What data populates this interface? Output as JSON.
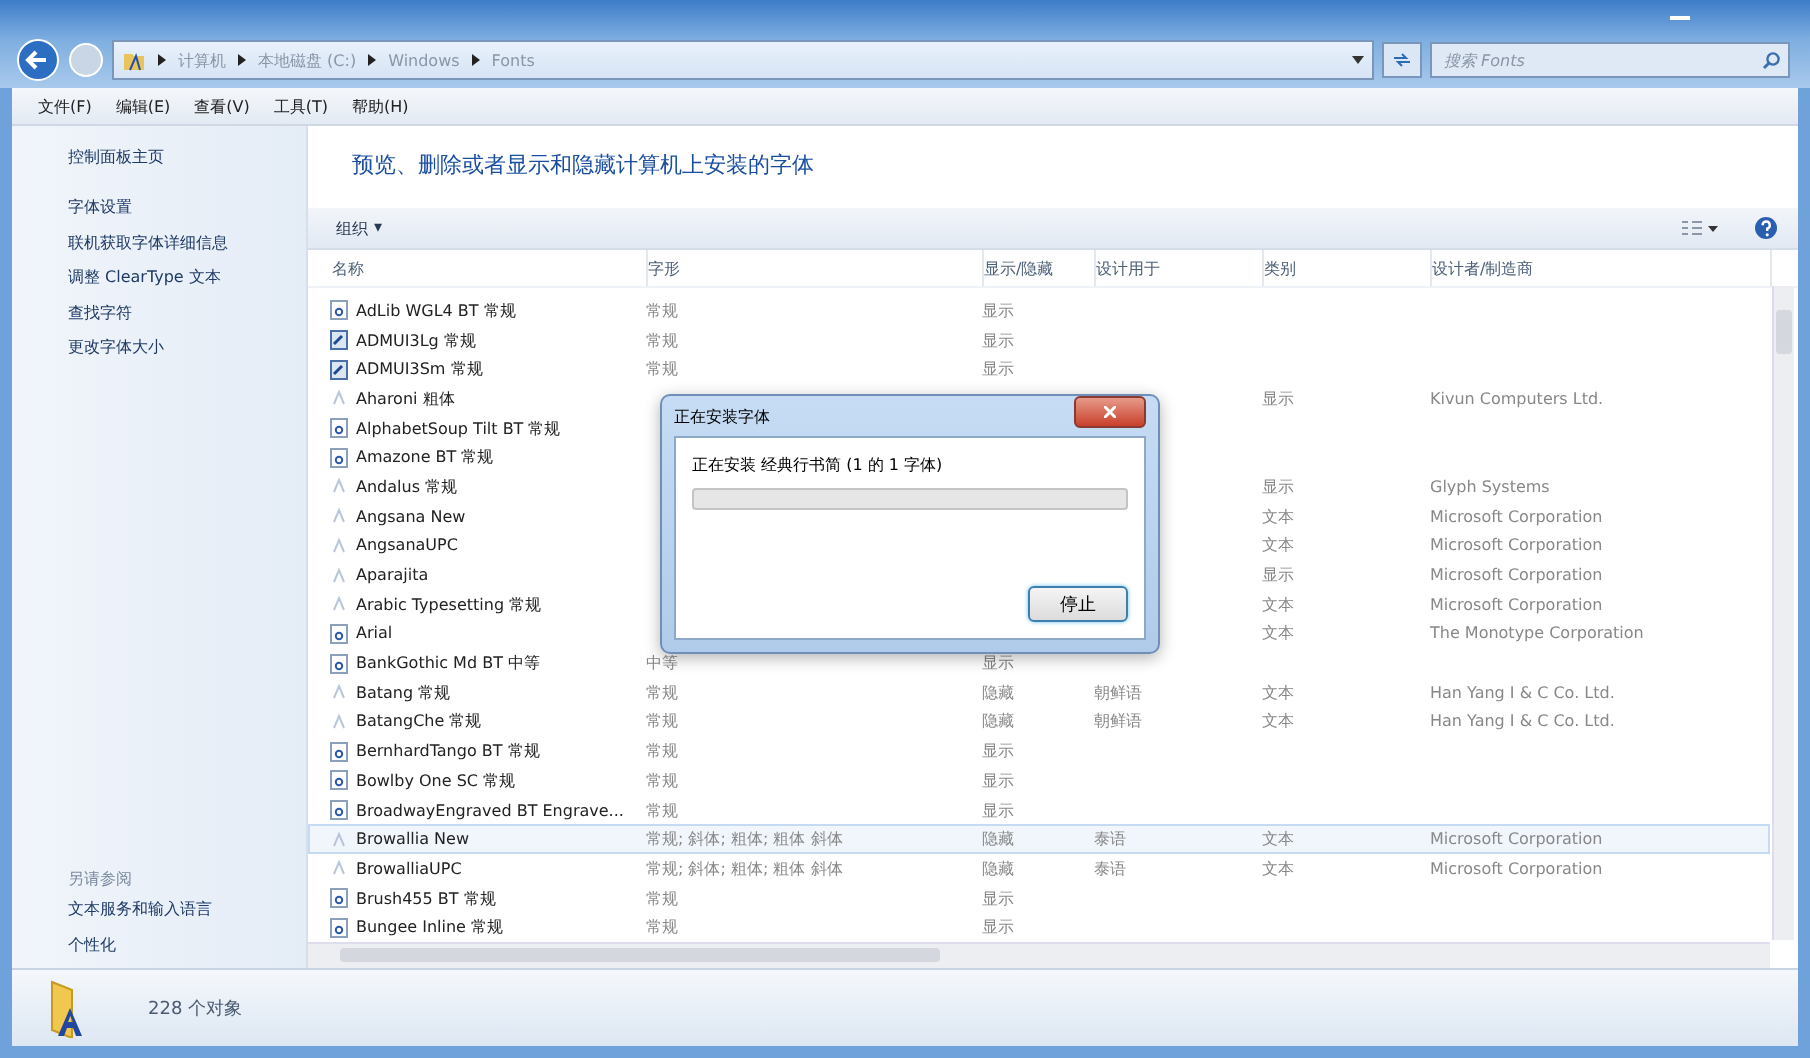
{
  "address_bar": {
    "path": [
      "计算机",
      "本地磁盘 (C:)",
      "Windows",
      "Fonts"
    ],
    "search": {
      "placeholder": "搜索 Fonts"
    }
  },
  "menu": [
    "文件(F)",
    "编辑(E)",
    "查看(V)",
    "工具(T)",
    "帮助(H)"
  ],
  "sidebar": {
    "home": "控制面板主页",
    "links": [
      "字体设置",
      "联机获取字体详细信息",
      "调整 ClearType 文本",
      "查找字符",
      "更改字体大小"
    ],
    "see_also": {
      "title": "另请参阅",
      "links": [
        "文本服务和输入语言",
        "个性化"
      ]
    }
  },
  "heading": "预览、删除或者显示和隐藏计算机上安装的字体",
  "toolbar": {
    "organize": "组织",
    "organize_caret": "▾"
  },
  "table": {
    "columns": [
      "名称",
      "字形",
      "显示/隐藏",
      "设计用于",
      "类别",
      "设计者/制造商"
    ],
    "rows": [
      {
        "kind": "font",
        "selected": false,
        "cells": [
          "AdLib WGL4 BT 常规",
          "常规",
          "显示",
          "",
          "",
          ""
        ]
      },
      {
        "kind": "postscript",
        "selected": false,
        "cells": [
          "ADMUI3Lg 常规",
          "常规",
          "显示",
          "",
          "",
          ""
        ]
      },
      {
        "kind": "postscript",
        "selected": false,
        "cells": [
          "ADMUI3Sm 常规",
          "常规",
          "显示",
          "",
          "",
          ""
        ]
      },
      {
        "kind": "faded",
        "selected": false,
        "cells": [
          "Aharoni 粗体",
          "",
          "",
          "",
          "显示",
          "Kivun Computers Ltd."
        ]
      },
      {
        "kind": "font",
        "selected": false,
        "cells": [
          "AlphabetSoup Tilt BT 常规",
          "",
          "",
          "",
          "",
          ""
        ]
      },
      {
        "kind": "font",
        "selected": false,
        "cells": [
          "Amazone BT 常规",
          "",
          "",
          "",
          "",
          ""
        ]
      },
      {
        "kind": "faded",
        "selected": false,
        "cells": [
          "Andalus 常规",
          "",
          "",
          "",
          "显示",
          "Glyph Systems"
        ]
      },
      {
        "kind": "faded",
        "selected": false,
        "cells": [
          "Angsana New",
          "",
          "",
          "",
          "文本",
          "Microsoft Corporation"
        ]
      },
      {
        "kind": "faded",
        "selected": false,
        "cells": [
          "AngsanaUPC",
          "",
          "",
          "",
          "文本",
          "Microsoft Corporation"
        ]
      },
      {
        "kind": "faded",
        "selected": false,
        "cells": [
          "Aparajita",
          "",
          "",
          "",
          "显示",
          "Microsoft Corporation"
        ]
      },
      {
        "kind": "faded",
        "selected": false,
        "cells": [
          "Arabic Typesetting 常规",
          "",
          "",
          "",
          "文本",
          "Microsoft Corporation"
        ]
      },
      {
        "kind": "font",
        "selected": false,
        "cells": [
          "Arial",
          "",
          "",
          "",
          "文本",
          "The Monotype Corporation"
        ]
      },
      {
        "kind": "font",
        "selected": false,
        "cells": [
          "BankGothic Md BT 中等",
          "中等",
          "显示",
          "",
          "",
          ""
        ]
      },
      {
        "kind": "faded",
        "selected": false,
        "cells": [
          "Batang 常规",
          "常规",
          "隐藏",
          "朝鲜语",
          "文本",
          "Han Yang I & C Co. Ltd."
        ]
      },
      {
        "kind": "faded",
        "selected": false,
        "cells": [
          "BatangChe 常规",
          "常规",
          "隐藏",
          "朝鲜语",
          "文本",
          "Han Yang I & C Co. Ltd."
        ]
      },
      {
        "kind": "font",
        "selected": false,
        "cells": [
          "BernhardTango BT 常规",
          "常规",
          "显示",
          "",
          "",
          ""
        ]
      },
      {
        "kind": "font",
        "selected": false,
        "cells": [
          "Bowlby One SC 常规",
          "常规",
          "显示",
          "",
          "",
          ""
        ]
      },
      {
        "kind": "font",
        "selected": false,
        "cells": [
          "BroadwayEngraved BT Engrave...",
          "常规",
          "显示",
          "",
          "",
          ""
        ]
      },
      {
        "kind": "faded",
        "selected": true,
        "cells": [
          "Browallia New",
          "常规; 斜体; 粗体; 粗体 斜体",
          "隐藏",
          "泰语",
          "文本",
          "Microsoft Corporation"
        ]
      },
      {
        "kind": "faded",
        "selected": false,
        "cells": [
          "BrowalliaUPC",
          "常规; 斜体; 粗体; 粗体 斜体",
          "隐藏",
          "泰语",
          "文本",
          "Microsoft Corporation"
        ]
      },
      {
        "kind": "font",
        "selected": false,
        "cells": [
          "Brush455 BT 常规",
          "常规",
          "显示",
          "",
          "",
          ""
        ]
      },
      {
        "kind": "font",
        "selected": false,
        "cells": [
          "Bungee Inline 常规",
          "常规",
          "显示",
          "",
          "",
          ""
        ]
      }
    ]
  },
  "dialog": {
    "title": "正在安装字体",
    "message": "正在安装 经典行书简 (1 的 1 字体)",
    "progress": {
      "level": 0
    },
    "button": "停止"
  },
  "status_bar": {
    "count": "228 个对象"
  }
}
